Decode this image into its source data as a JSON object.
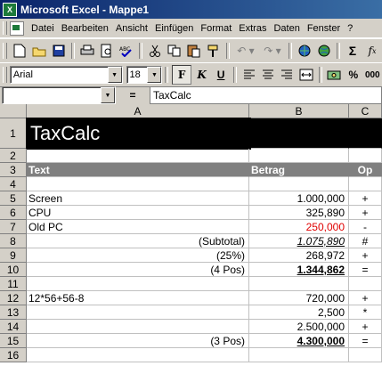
{
  "window": {
    "title": "Microsoft Excel - Mappe1"
  },
  "menu": [
    "Datei",
    "Bearbeiten",
    "Ansicht",
    "Einfügen",
    "Format",
    "Extras",
    "Daten",
    "Fenster",
    "?"
  ],
  "format_toolbar": {
    "font": "Arial",
    "size": "18",
    "bold": "F",
    "italic": "K",
    "underline": "U",
    "percent": "%",
    "thousands": "000"
  },
  "formula_bar": {
    "name_box": "",
    "equals": "=",
    "value": "TaxCalc"
  },
  "columns": [
    "A",
    "B",
    "C"
  ],
  "rows": [
    {
      "n": "1",
      "a": "TaxCalc",
      "b": "",
      "c": ""
    },
    {
      "n": "2",
      "a": "",
      "b": "",
      "c": ""
    },
    {
      "n": "3",
      "a": "Text",
      "b": "Betrag",
      "c": "Op"
    },
    {
      "n": "4",
      "a": "",
      "b": "",
      "c": ""
    },
    {
      "n": "5",
      "a": "Screen",
      "b": "1.000,000",
      "c": "+"
    },
    {
      "n": "6",
      "a": "CPU",
      "b": "325,890",
      "c": "+"
    },
    {
      "n": "7",
      "a": "Old PC",
      "b": "250,000",
      "c": "-"
    },
    {
      "n": "8",
      "a": "(Subtotal)",
      "b": "1.075,890",
      "c": "#"
    },
    {
      "n": "9",
      "a": "(25%)",
      "b": "268,972",
      "c": "+"
    },
    {
      "n": "10",
      "a": "(4 Pos)",
      "b": "1.344,862",
      "c": "="
    },
    {
      "n": "11",
      "a": "",
      "b": "",
      "c": ""
    },
    {
      "n": "12",
      "a": "12*56+56-8",
      "b": "720,000",
      "c": "+"
    },
    {
      "n": "13",
      "a": "",
      "b": "2,500",
      "c": "*"
    },
    {
      "n": "14",
      "a": "",
      "b": "2.500,000",
      "c": "+"
    },
    {
      "n": "15",
      "a": "(3 Pos)",
      "b": "4.300,000",
      "c": "="
    },
    {
      "n": "16",
      "a": "",
      "b": "",
      "c": ""
    }
  ],
  "colors": {
    "title_bg": "#000000",
    "header_bg": "#808080",
    "negative": "#e00000",
    "titlebar": "#0a246a"
  }
}
